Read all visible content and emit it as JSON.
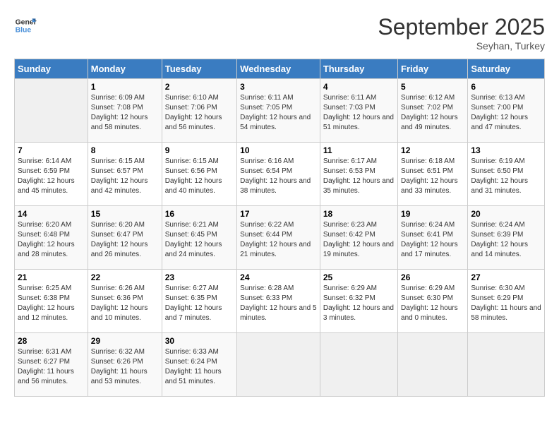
{
  "logo": {
    "text_general": "General",
    "text_blue": "Blue"
  },
  "title": "September 2025",
  "subtitle": "Seyhan, Turkey",
  "days_of_week": [
    "Sunday",
    "Monday",
    "Tuesday",
    "Wednesday",
    "Thursday",
    "Friday",
    "Saturday"
  ],
  "weeks": [
    [
      {
        "empty": true
      },
      {
        "day": "1",
        "sunrise": "6:09 AM",
        "sunset": "7:08 PM",
        "daylight": "12 hours and 58 minutes."
      },
      {
        "day": "2",
        "sunrise": "6:10 AM",
        "sunset": "7:06 PM",
        "daylight": "12 hours and 56 minutes."
      },
      {
        "day": "3",
        "sunrise": "6:11 AM",
        "sunset": "7:05 PM",
        "daylight": "12 hours and 54 minutes."
      },
      {
        "day": "4",
        "sunrise": "6:11 AM",
        "sunset": "7:03 PM",
        "daylight": "12 hours and 51 minutes."
      },
      {
        "day": "5",
        "sunrise": "6:12 AM",
        "sunset": "7:02 PM",
        "daylight": "12 hours and 49 minutes."
      },
      {
        "day": "6",
        "sunrise": "6:13 AM",
        "sunset": "7:00 PM",
        "daylight": "12 hours and 47 minutes."
      }
    ],
    [
      {
        "day": "7",
        "sunrise": "6:14 AM",
        "sunset": "6:59 PM",
        "daylight": "12 hours and 45 minutes."
      },
      {
        "day": "8",
        "sunrise": "6:15 AM",
        "sunset": "6:57 PM",
        "daylight": "12 hours and 42 minutes."
      },
      {
        "day": "9",
        "sunrise": "6:15 AM",
        "sunset": "6:56 PM",
        "daylight": "12 hours and 40 minutes."
      },
      {
        "day": "10",
        "sunrise": "6:16 AM",
        "sunset": "6:54 PM",
        "daylight": "12 hours and 38 minutes."
      },
      {
        "day": "11",
        "sunrise": "6:17 AM",
        "sunset": "6:53 PM",
        "daylight": "12 hours and 35 minutes."
      },
      {
        "day": "12",
        "sunrise": "6:18 AM",
        "sunset": "6:51 PM",
        "daylight": "12 hours and 33 minutes."
      },
      {
        "day": "13",
        "sunrise": "6:19 AM",
        "sunset": "6:50 PM",
        "daylight": "12 hours and 31 minutes."
      }
    ],
    [
      {
        "day": "14",
        "sunrise": "6:20 AM",
        "sunset": "6:48 PM",
        "daylight": "12 hours and 28 minutes."
      },
      {
        "day": "15",
        "sunrise": "6:20 AM",
        "sunset": "6:47 PM",
        "daylight": "12 hours and 26 minutes."
      },
      {
        "day": "16",
        "sunrise": "6:21 AM",
        "sunset": "6:45 PM",
        "daylight": "12 hours and 24 minutes."
      },
      {
        "day": "17",
        "sunrise": "6:22 AM",
        "sunset": "6:44 PM",
        "daylight": "12 hours and 21 minutes."
      },
      {
        "day": "18",
        "sunrise": "6:23 AM",
        "sunset": "6:42 PM",
        "daylight": "12 hours and 19 minutes."
      },
      {
        "day": "19",
        "sunrise": "6:24 AM",
        "sunset": "6:41 PM",
        "daylight": "12 hours and 17 minutes."
      },
      {
        "day": "20",
        "sunrise": "6:24 AM",
        "sunset": "6:39 PM",
        "daylight": "12 hours and 14 minutes."
      }
    ],
    [
      {
        "day": "21",
        "sunrise": "6:25 AM",
        "sunset": "6:38 PM",
        "daylight": "12 hours and 12 minutes."
      },
      {
        "day": "22",
        "sunrise": "6:26 AM",
        "sunset": "6:36 PM",
        "daylight": "12 hours and 10 minutes."
      },
      {
        "day": "23",
        "sunrise": "6:27 AM",
        "sunset": "6:35 PM",
        "daylight": "12 hours and 7 minutes."
      },
      {
        "day": "24",
        "sunrise": "6:28 AM",
        "sunset": "6:33 PM",
        "daylight": "12 hours and 5 minutes."
      },
      {
        "day": "25",
        "sunrise": "6:29 AM",
        "sunset": "6:32 PM",
        "daylight": "12 hours and 3 minutes."
      },
      {
        "day": "26",
        "sunrise": "6:29 AM",
        "sunset": "6:30 PM",
        "daylight": "12 hours and 0 minutes."
      },
      {
        "day": "27",
        "sunrise": "6:30 AM",
        "sunset": "6:29 PM",
        "daylight": "11 hours and 58 minutes."
      }
    ],
    [
      {
        "day": "28",
        "sunrise": "6:31 AM",
        "sunset": "6:27 PM",
        "daylight": "11 hours and 56 minutes."
      },
      {
        "day": "29",
        "sunrise": "6:32 AM",
        "sunset": "6:26 PM",
        "daylight": "11 hours and 53 minutes."
      },
      {
        "day": "30",
        "sunrise": "6:33 AM",
        "sunset": "6:24 PM",
        "daylight": "11 hours and 51 minutes."
      },
      {
        "empty": true
      },
      {
        "empty": true
      },
      {
        "empty": true
      },
      {
        "empty": true
      }
    ]
  ]
}
